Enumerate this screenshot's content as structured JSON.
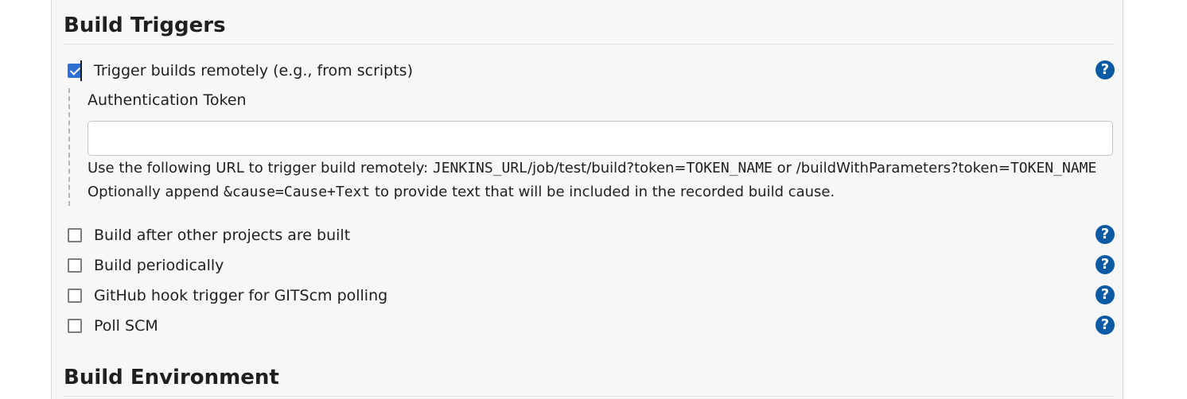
{
  "build_triggers": {
    "title": "Build Triggers",
    "remote": {
      "label": "Trigger builds remotely (e.g., from scripts)",
      "checked": true,
      "help_icon": "help-circle-icon",
      "token_label": "Authentication Token",
      "token_value": "",
      "url_line": {
        "prefix": "Use the following URL to trigger build remotely: ",
        "url_var": "JENKINS_URL",
        "url_path": "/job/test/build?token=",
        "token_var": "TOKEN_NAME",
        "or_text": " or /buildWithParameters?token=",
        "token_var2": "TOKEN_NAME"
      },
      "cause_line": {
        "prefix": "Optionally append ",
        "code": "&cause=Cause+Text",
        "suffix": " to provide text that will be included in the recorded build cause."
      }
    },
    "options": [
      {
        "label": "Build after other projects are built",
        "checked": false
      },
      {
        "label": "Build periodically",
        "checked": false
      },
      {
        "label": "GitHub hook trigger for GITScm polling",
        "checked": false
      },
      {
        "label": "Poll SCM",
        "checked": false
      }
    ],
    "help_glyph": "?"
  },
  "build_environment": {
    "title": "Build Environment"
  },
  "colors": {
    "panel_bg": "#f7f7f7",
    "checkbox_checked": "#2f6fd0",
    "help_icon": "#0b5aa4"
  }
}
